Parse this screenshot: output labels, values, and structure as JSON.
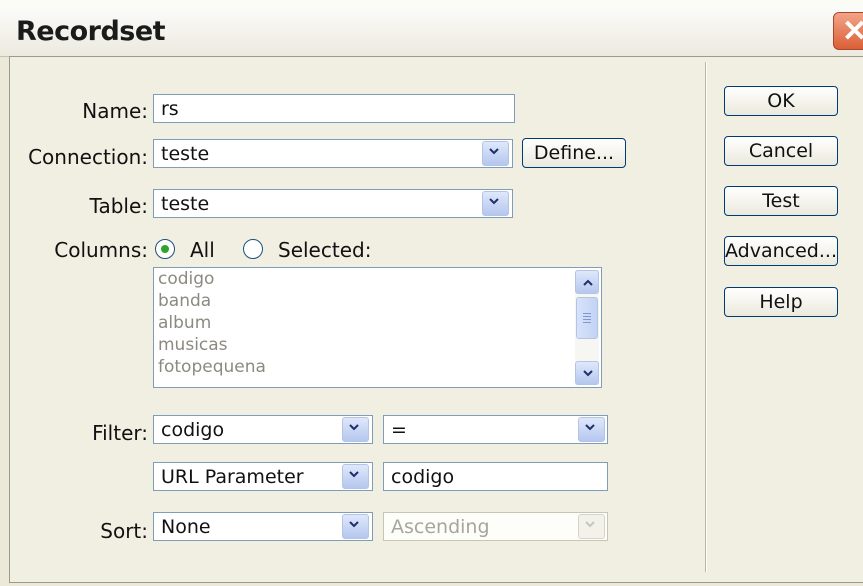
{
  "dialog": {
    "title": "Recordset"
  },
  "form": {
    "name_label": "Name:",
    "name_value": "rs",
    "connection_label": "Connection:",
    "connection_value": "teste",
    "define_button": "Define...",
    "table_label": "Table:",
    "table_value": "teste",
    "columns_label": "Columns:",
    "columns_all": "All",
    "columns_selected": "Selected:",
    "columns_selected_option": "All",
    "column_items": [
      "codigo",
      "banda",
      "album",
      "musicas",
      "fotopequena"
    ],
    "filter_label": "Filter:",
    "filter_column": "codigo",
    "filter_operator": "=",
    "filter_source": "URL Parameter",
    "filter_value": "codigo",
    "sort_label": "Sort:",
    "sort_value": "None",
    "sort_order": "Ascending"
  },
  "buttons": {
    "ok": "OK",
    "cancel": "Cancel",
    "test": "Test",
    "advanced": "Advanced...",
    "help": "Help"
  },
  "colors": {
    "title_close": "#db5f37",
    "field_border": "#7f9db9",
    "radio_dot": "#2ba52b"
  },
  "icons": [
    "close-icon",
    "chevron-down-icon",
    "chevron-up-icon"
  ]
}
